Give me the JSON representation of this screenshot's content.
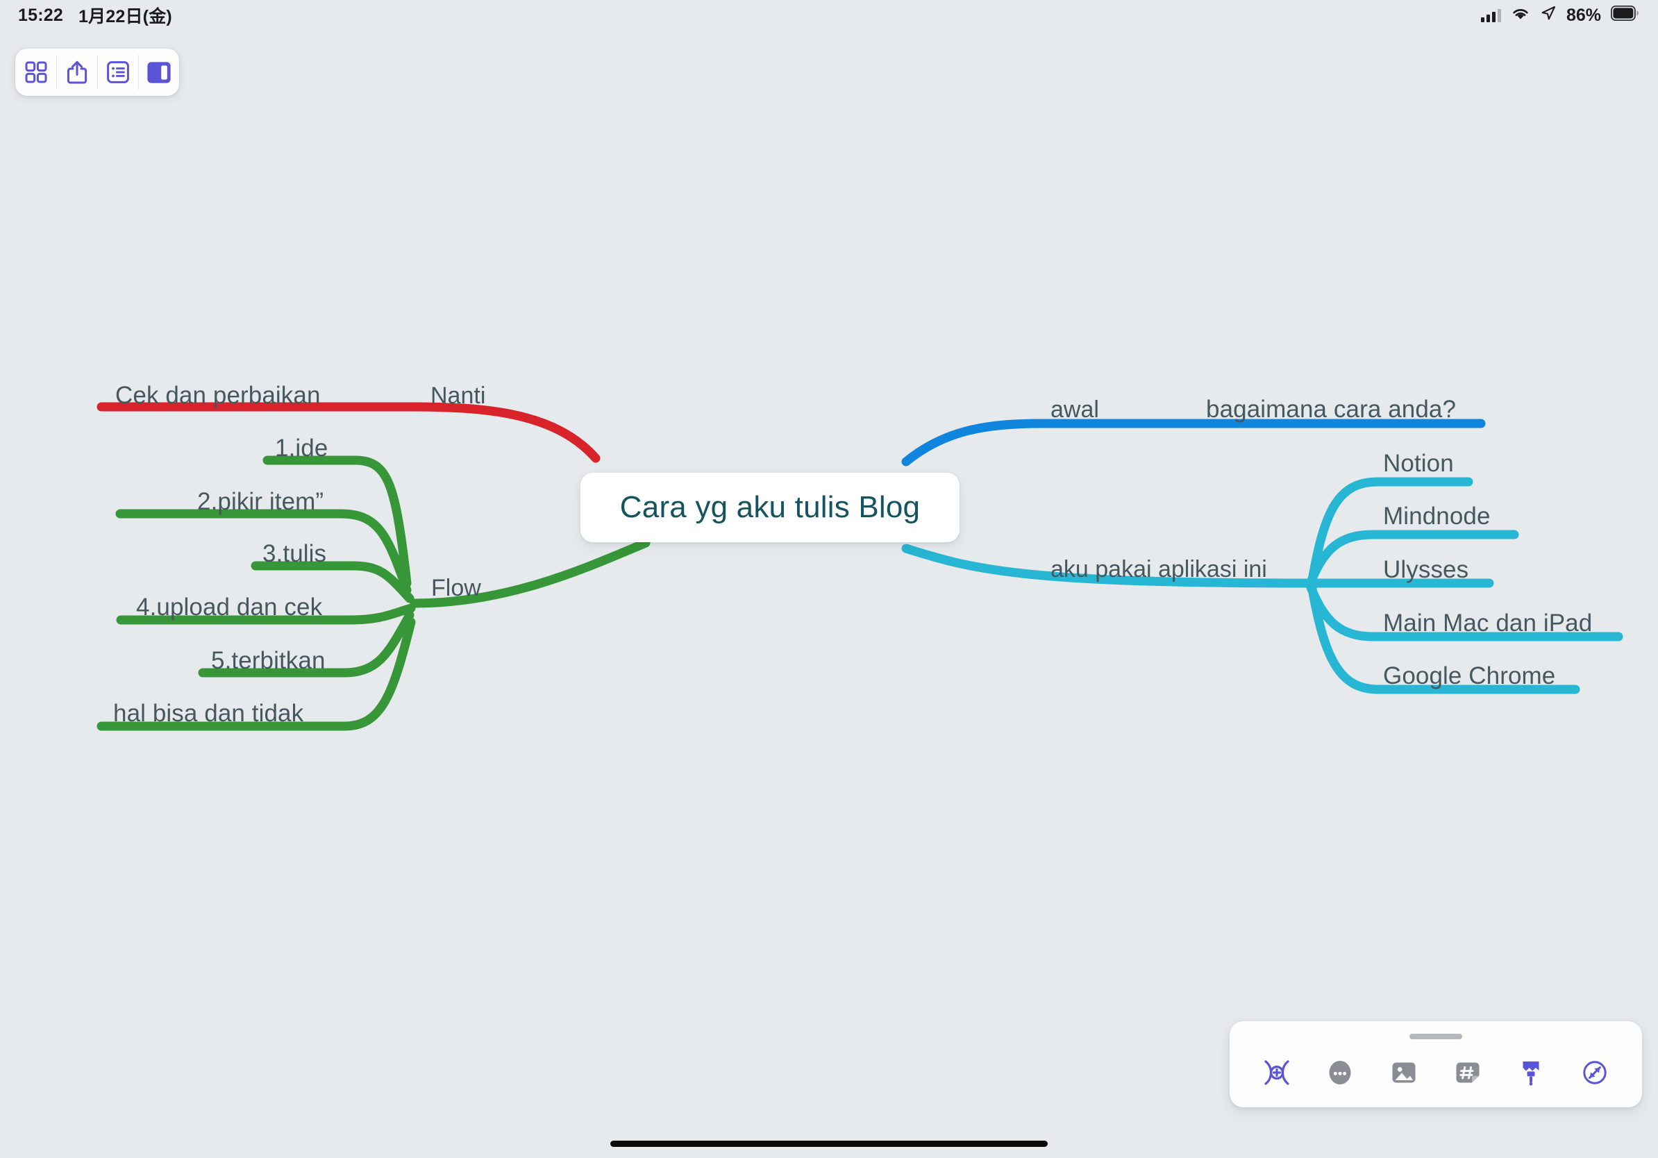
{
  "status_bar": {
    "time": "15:22",
    "date": "1月22日(金)",
    "battery_percent": "86%",
    "icons": [
      "cellular-signal-icon",
      "wifi-icon",
      "location-arrow-icon",
      "battery-icon"
    ]
  },
  "top_toolbar": {
    "buttons": [
      {
        "name": "grid-view-button",
        "icon": "grid-icon",
        "active": false
      },
      {
        "name": "share-button",
        "icon": "share-icon",
        "active": false
      },
      {
        "name": "outline-button",
        "icon": "outline-list-icon",
        "active": false
      },
      {
        "name": "sidebar-toggle-button",
        "icon": "sidebar-panel-icon",
        "active": true
      }
    ],
    "accent_color": "#5B54D6"
  },
  "mindmap": {
    "central_node": {
      "title": "Cara yg aku tulis Blog",
      "text_color": "#14535F",
      "background": "#FFFFFF"
    },
    "branches": [
      {
        "id": "red-branch",
        "color": "#D8232A",
        "side": "left",
        "label": "Nanti",
        "children": [
          "Cek dan perbaikan"
        ]
      },
      {
        "id": "green-branch",
        "color": "#379637",
        "side": "left",
        "label": "Flow",
        "children": [
          "1.ide",
          "2.pikir item”",
          "3.tulis",
          "4.upload dan cek",
          "5.terbitkan",
          "hal bisa dan tidak"
        ]
      },
      {
        "id": "blue-branch",
        "color": "#1085DE",
        "side": "right",
        "label": "awal",
        "children": [
          "bagaimana cara anda?"
        ]
      },
      {
        "id": "cyan-branch",
        "color": "#27B6D3",
        "side": "right",
        "label": "aku pakai aplikasi ini",
        "children": [
          "Notion",
          "Mindnode",
          "Ulysses",
          "Main Mac dan iPad",
          "Google Chrome"
        ]
      }
    ]
  },
  "bottom_toolbar": {
    "icons": [
      {
        "name": "add-connection-button",
        "icon": "node-connect-plus-icon",
        "color": "#5B54D6"
      },
      {
        "name": "note-button",
        "icon": "note-ellipsis-icon",
        "color": "#8B8D94"
      },
      {
        "name": "image-button",
        "icon": "image-icon",
        "color": "#8B8D94"
      },
      {
        "name": "tag-button",
        "icon": "hashtag-tag-icon",
        "color": "#8B8D94"
      },
      {
        "name": "style-brush-button",
        "icon": "paintbrush-icon",
        "color": "#5B54D6"
      },
      {
        "name": "more-options-button",
        "icon": "circled-slash-arrow-icon",
        "color": "#5B54D6"
      }
    ]
  },
  "canvas": {
    "background": "#E6EAEC"
  }
}
